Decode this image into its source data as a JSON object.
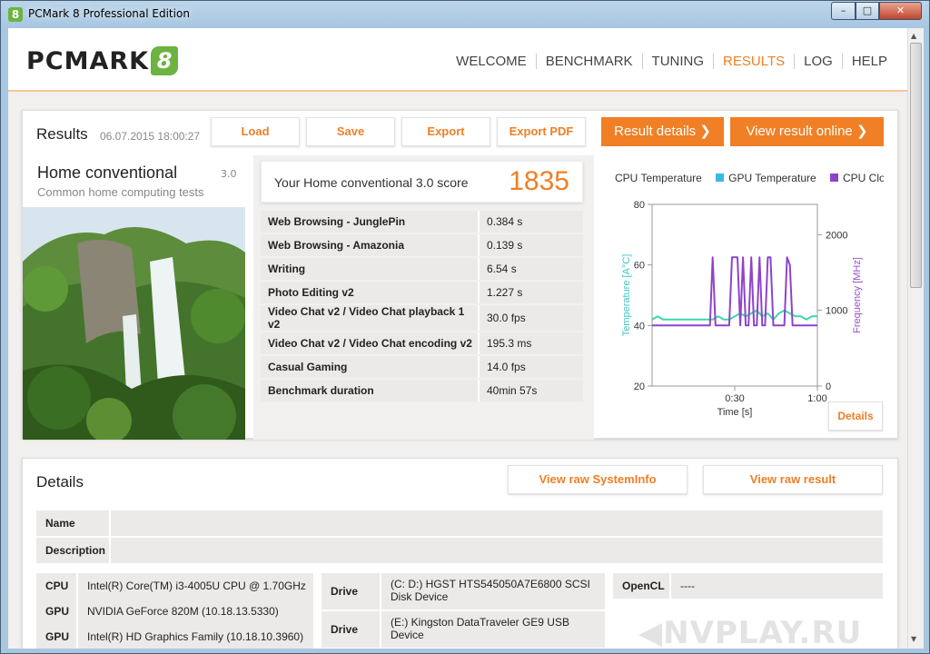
{
  "window": {
    "title": "PCMark 8 Professional Edition",
    "min": "–",
    "max": "□",
    "close": "✕"
  },
  "nav": [
    "WELCOME",
    "BENCHMARK",
    "TUNING",
    "RESULTS",
    "LOG",
    "HELP"
  ],
  "logo": {
    "text": "PCMARK",
    "digit": "8"
  },
  "results": {
    "title": "Results",
    "date": "06.07.2015 18:00:27",
    "buttons": {
      "load": "Load",
      "save": "Save",
      "export": "Export",
      "export_pdf": "Export PDF",
      "result_details": "Result details ❯",
      "view_online": "View result online ❯"
    },
    "test_name": "Home conventional",
    "test_version": "3.0",
    "test_desc": "Common home computing tests",
    "score_label": "Your Home conventional 3.0 score",
    "score": "1835",
    "subscores": [
      {
        "name": "Web Browsing - JunglePin",
        "value": "0.384 s"
      },
      {
        "name": "Web Browsing - Amazonia",
        "value": "0.139 s"
      },
      {
        "name": "Writing",
        "value": "6.54 s"
      },
      {
        "name": "Photo Editing v2",
        "value": "1.227 s"
      },
      {
        "name": "Video Chat v2 / Video Chat playback 1 v2",
        "value": "30.0 fps"
      },
      {
        "name": "Video Chat v2 / Video Chat encoding v2",
        "value": "195.3 ms"
      },
      {
        "name": "Casual Gaming",
        "value": "14.0 fps"
      },
      {
        "name": "Benchmark duration",
        "value": "40min 57s"
      }
    ],
    "chart_details": "Details"
  },
  "chart_data": {
    "type": "line",
    "legend": [
      {
        "name": "CPU Temperature",
        "color": "#ffffff"
      },
      {
        "name": "GPU Temperature",
        "color": "#3cb8e6"
      },
      {
        "name": "CPU Clock",
        "color": "#8e44c9"
      }
    ],
    "xlabel": "Time [s]",
    "x_ticks": [
      "0:30",
      "1:00"
    ],
    "xlim": [
      0,
      60
    ],
    "ylabel_left": "Temperature [A°C]",
    "ylim_left": [
      20,
      80
    ],
    "y_ticks_left": [
      20,
      40,
      60,
      80
    ],
    "ylabel_right": "Frequency [MHz]",
    "ylim_right": [
      0,
      2400
    ],
    "y_ticks_right": [
      0,
      1000,
      2000
    ],
    "series": [
      {
        "name": "GPU Temperature",
        "axis": "left",
        "color": "#3cd6b0",
        "x": [
          0,
          2,
          4,
          10,
          16,
          20,
          22,
          24,
          26,
          28,
          30,
          32,
          34,
          36,
          38,
          40,
          42,
          44,
          46,
          48,
          50,
          52,
          54,
          56,
          58,
          60
        ],
        "y": [
          42,
          43,
          42,
          42,
          42,
          42,
          42,
          43,
          42,
          42,
          43,
          44,
          43,
          44,
          45,
          43,
          44,
          42,
          44,
          45,
          44,
          43,
          43,
          42,
          43,
          43
        ]
      },
      {
        "name": "CPU Clock",
        "axis": "right",
        "color": "#8e44c9",
        "x": [
          0,
          20,
          21,
          22,
          23,
          24,
          27,
          28,
          29,
          31,
          32,
          33,
          34,
          35,
          36,
          37,
          38,
          39,
          40,
          41,
          42,
          43,
          44,
          47,
          48,
          49,
          50,
          51,
          52,
          55,
          56,
          60
        ],
        "y": [
          800,
          800,
          800,
          1700,
          800,
          800,
          800,
          800,
          1700,
          1700,
          800,
          1700,
          800,
          800,
          1700,
          800,
          800,
          1700,
          800,
          800,
          1700,
          1700,
          800,
          800,
          800,
          1700,
          1600,
          800,
          800,
          800,
          800,
          800
        ]
      }
    ]
  },
  "details": {
    "title": "Details",
    "btn_sysinfo": "View raw SystemInfo",
    "btn_rawresult": "View raw result",
    "name_label": "Name",
    "name_value": "",
    "desc_label": "Description",
    "desc_value": "",
    "hw_left": [
      {
        "key": "CPU",
        "value": "Intel(R) Core(TM) i3-4005U CPU @ 1.70GHz"
      },
      {
        "key": "GPU",
        "value": "NVIDIA GeForce 820M (10.18.13.5330)"
      },
      {
        "key": "GPU",
        "value": "Intel(R) HD Graphics Family (10.18.10.3960)"
      }
    ],
    "drives": [
      {
        "key": "Drive",
        "value": "(C: D:) HGST HTS545050A7E6800 SCSI Disk Device"
      },
      {
        "key": "Drive",
        "value": "(E:) Kingston DataTraveler GE9 USB Device"
      }
    ],
    "opencl": {
      "key": "OpenCL",
      "value": "----"
    },
    "watermark": "◀NVPLAY.RU"
  }
}
